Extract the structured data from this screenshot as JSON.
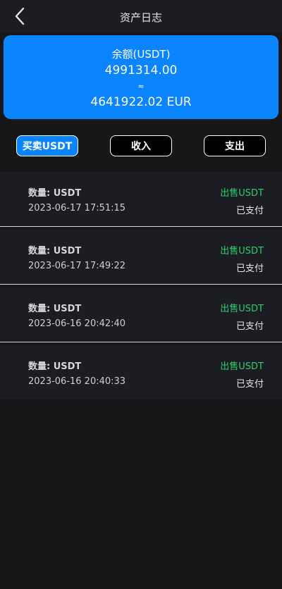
{
  "header": {
    "title": "资产日志",
    "back_icon": "chevron-left-icon"
  },
  "balance": {
    "label": "余额(USDT)",
    "value": "4991314.00",
    "approx": "≈",
    "fiat": "4641922.02 EUR"
  },
  "tabs": [
    {
      "label": "买卖USDT",
      "active": true
    },
    {
      "label": "收入",
      "active": false
    },
    {
      "label": "支出",
      "active": false
    }
  ],
  "records": [
    {
      "amount": "数量: USDT",
      "time": "2023-06-17 17:51:15",
      "type": "出售USDT",
      "status": "已支付"
    },
    {
      "amount": "数量: USDT",
      "time": "2023-06-17 17:49:22",
      "type": "出售USDT",
      "status": "已支付"
    },
    {
      "amount": "数量: USDT",
      "time": "2023-06-16 20:42:40",
      "type": "出售USDT",
      "status": "已支付"
    },
    {
      "amount": "数量: USDT",
      "time": "2023-06-16 20:40:33",
      "type": "出售USDT",
      "status": "已支付"
    }
  ],
  "colors": {
    "accent": "#0a84ff",
    "sell": "#2ecc71",
    "background": "#151719",
    "row": "#1b1d22"
  }
}
